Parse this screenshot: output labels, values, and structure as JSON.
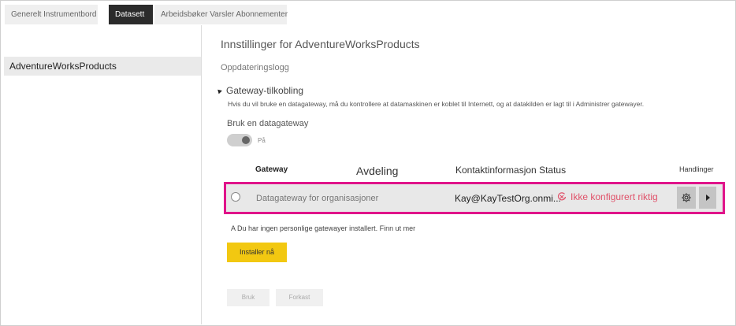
{
  "tabs": {
    "general": "Generelt",
    "dashboard": "Instrumentbord",
    "datasets": "Datasett",
    "workbooks": "Arbeidsbøker",
    "alerts": "Varsler",
    "subscriptions": "Abonnementer"
  },
  "sidebar": {
    "items": [
      {
        "label": "AdventureWorksProducts"
      }
    ]
  },
  "main": {
    "settings_title": "Innstillinger for AdventureWorksProducts",
    "refresh_log": "Oppdateringslogg",
    "gateway_section": {
      "label": "Gateway-tilkobling",
      "description": "Hvis du vil bruke en datagateway, må du kontrollere at datamaskinen er koblet til Internett, og at datakilden er lagt til i Administrer gatewayer.",
      "use_gateway_label": "Bruk en datagateway",
      "toggle_state": "På",
      "toggle_on": true
    },
    "table": {
      "headers": {
        "gateway": "Gateway",
        "department": "Avdeling",
        "contact": "Kontaktinformasjon",
        "status": "Status",
        "actions": "Handlinger"
      },
      "rows": [
        {
          "name": "Datagateway for organisasjoner",
          "contact": "Kay@KayTestOrg.onmi...",
          "status": "Ikke konfigurert riktig",
          "status_color": "#e0526a"
        }
      ]
    },
    "personal_note": "A Du har ingen personlige gatewayer installert. Finn ut mer",
    "install_button": "Installer nå",
    "apply_button": "Bruk",
    "discard_button": "Forkast"
  },
  "colors": {
    "highlight_border": "#e0148a",
    "install_button_bg": "#f2c811",
    "active_tab_bg": "#2b2b2b"
  },
  "icons": [
    "triangle-expand-icon",
    "radio-icon",
    "warning-status-icon",
    "gear-icon",
    "play-icon"
  ]
}
